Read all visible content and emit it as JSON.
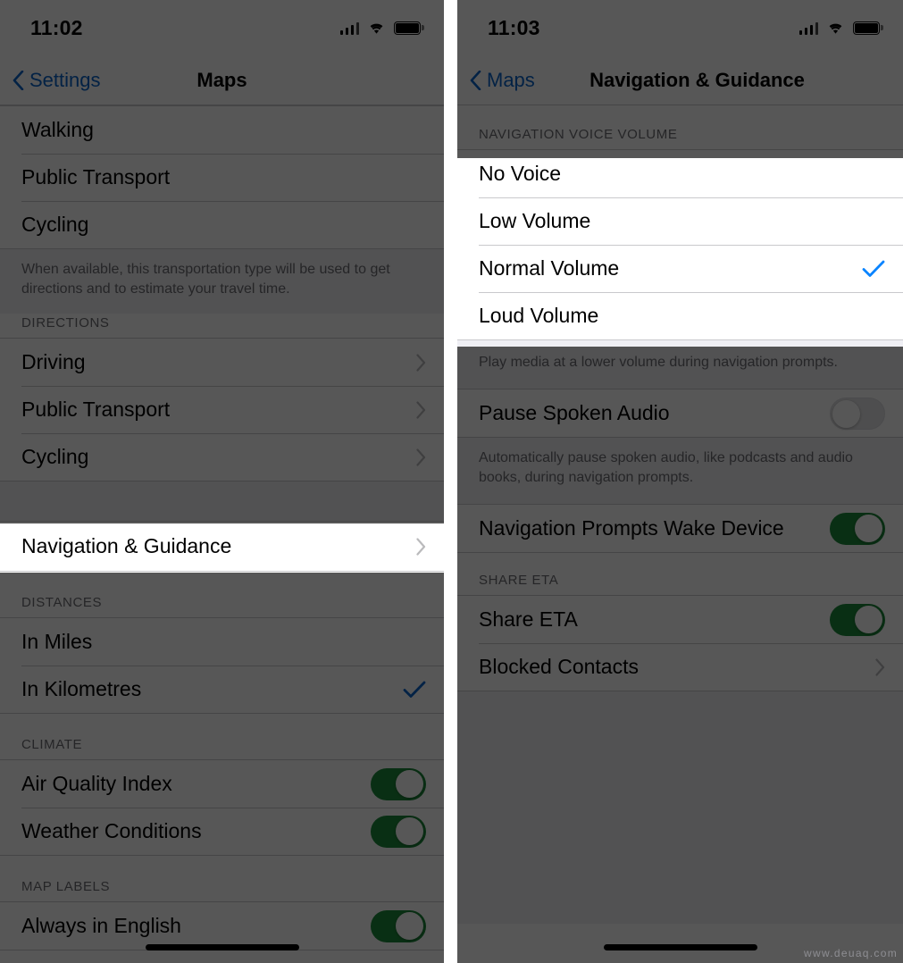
{
  "watermark": "www.deuaq.com",
  "left_panel": {
    "status_bar": {
      "time": "11:02",
      "signal_icon": "cellular-signal-icon",
      "wifi_icon": "wifi-icon",
      "battery_icon": "battery-icon"
    },
    "nav": {
      "back_label": "Settings",
      "title": "Maps",
      "back_icon": "chevron-left-icon"
    },
    "preferred_transport_rows": [
      {
        "label": "Walking"
      },
      {
        "label": "Public Transport"
      },
      {
        "label": "Cycling"
      }
    ],
    "preferred_transport_footnote": "When available, this transportation type will be used to get directions and to estimate your travel time.",
    "directions_header": "DIRECTIONS",
    "directions_rows": [
      {
        "label": "Driving",
        "accessory": "chevron-right-icon"
      },
      {
        "label": "Public Transport",
        "accessory": "chevron-right-icon"
      },
      {
        "label": "Cycling",
        "accessory": "chevron-right-icon"
      }
    ],
    "highlighted_row": {
      "label": "Navigation & Guidance",
      "accessory": "chevron-right-icon"
    },
    "distances_header": "DISTANCES",
    "distances_rows": [
      {
        "label": "In Miles",
        "checked": false
      },
      {
        "label": "In Kilometres",
        "checked": true
      }
    ],
    "climate_header": "CLIMATE",
    "climate_rows": [
      {
        "label": "Air Quality Index",
        "toggle": "on"
      },
      {
        "label": "Weather Conditions",
        "toggle": "on"
      }
    ],
    "map_labels_header": "MAP LABELS",
    "map_labels_rows": [
      {
        "label": "Always in English",
        "toggle": "on"
      }
    ]
  },
  "right_panel": {
    "status_bar": {
      "time": "11:03",
      "signal_icon": "cellular-signal-icon",
      "wifi_icon": "wifi-icon",
      "battery_icon": "battery-icon"
    },
    "nav": {
      "back_label": "Maps",
      "title": "Navigation & Guidance",
      "back_icon": "chevron-left-icon"
    },
    "voice_volume_header": "NAVIGATION VOICE VOLUME",
    "voice_volume_rows": [
      {
        "label": "No Voice",
        "checked": false
      },
      {
        "label": "Low Volume",
        "checked": false
      },
      {
        "label": "Normal Volume",
        "checked": true
      },
      {
        "label": "Loud Volume",
        "checked": false
      }
    ],
    "voice_volume_footnote": "Play media at a lower volume during navigation prompts.",
    "pause_row": {
      "label": "Pause Spoken Audio",
      "toggle": "off"
    },
    "pause_footnote": "Automatically pause spoken audio, like podcasts and audio books, during navigation prompts.",
    "wake_row": {
      "label": "Navigation Prompts Wake Device",
      "toggle": "on"
    },
    "share_eta_header": "SHARE ETA",
    "share_eta_rows": [
      {
        "label": "Share ETA",
        "toggle": "on"
      },
      {
        "label": "Blocked Contacts",
        "accessory": "chevron-right-icon"
      }
    ]
  },
  "colors": {
    "accent_blue": "#0a84ff",
    "link_blue": "#0a63c9",
    "toggle_green": "#1d8a3b",
    "group_bg": "#efeff4",
    "separator": "#c9c9cc",
    "secondary_text": "#6d6d72",
    "scrim": "rgba(0,0,0,0.66)"
  }
}
